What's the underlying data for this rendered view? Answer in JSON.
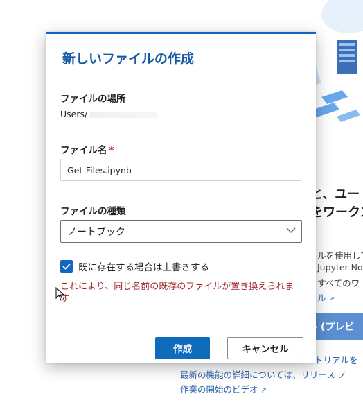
{
  "dialog": {
    "title": "新しいファイルの作成",
    "location_label": "ファイルの場所",
    "location_value": "Users/",
    "filename_label": "ファイル名",
    "required_mark": "*",
    "filename_value": "Get-Files.ipynb",
    "filetype_label": "ファイルの種類",
    "filetype_selected": "ノートブック",
    "overwrite_label": "既に存在する場合は上書きする",
    "overwrite_checked": true,
    "warning_text": "これにより、同じ名前の既存のファイルが置き換えられます",
    "create_button": "作成",
    "cancel_button": "キャンセル"
  },
  "background": {
    "heading_line1": "と、ユー",
    "heading_line2": "をワークス",
    "text_line1": "ルを使用して",
    "text_line2": "Jupyter No",
    "text_line3": "すべてのワ",
    "link_text": "ル",
    "button_label": "ル (プレビ",
    "bottom_line1": "トリアルを",
    "bottom_line2": "最新の機能の詳細については、リリース ノ",
    "bottom_line3": "作業の開始のビデオ"
  },
  "colors": {
    "accent": "#0f6cbd",
    "title": "#1558a6",
    "warning": "#a4262c",
    "required": "#c50f1f"
  }
}
